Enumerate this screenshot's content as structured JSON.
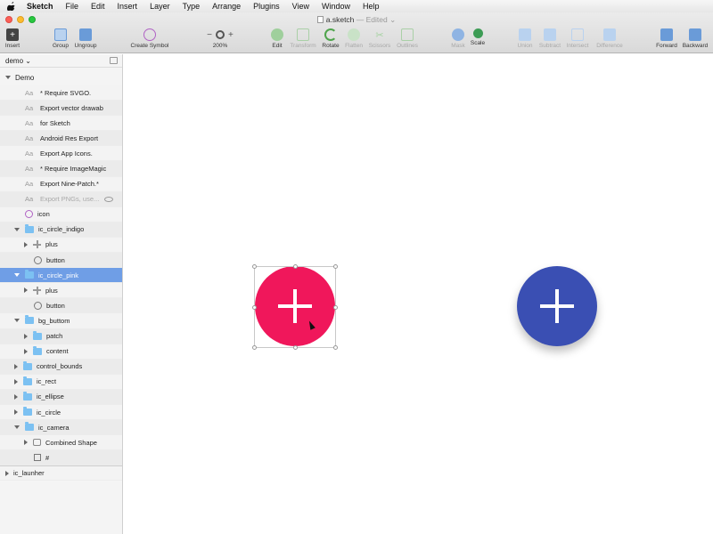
{
  "menubar": {
    "app": "Sketch",
    "items": [
      "File",
      "Edit",
      "Insert",
      "Layer",
      "Type",
      "Arrange",
      "Plugins",
      "View",
      "Window",
      "Help"
    ]
  },
  "window": {
    "title": "a.sketch",
    "status": "— Edited ⌄"
  },
  "toolbar": {
    "insert": "Insert",
    "group": "Group",
    "ungroup": "Ungroup",
    "create_symbol": "Create Symbol",
    "zoom_minus": "−",
    "zoom_plus": "+",
    "zoom": "200%",
    "edit": "Edit",
    "transform": "Transform",
    "rotate": "Rotate",
    "flatten": "Flatten",
    "scissors": "Scissors",
    "outlines": "Outlines",
    "mask": "Mask",
    "scale": "Scale",
    "union": "Union",
    "subtract": "Subtract",
    "intersect": "Intersect",
    "difference": "Difference",
    "forward": "Forward",
    "backward": "Backward"
  },
  "sidebar": {
    "page_selector": "demo ⌄",
    "page": "Demo",
    "layers": [
      {
        "label": "* Require SVGO."
      },
      {
        "label": "Export vector drawab"
      },
      {
        "label": "for Sketch"
      },
      {
        "label": "Android Res Export"
      },
      {
        "label": "Export App Icons."
      },
      {
        "label": "* Require ImageMagic"
      },
      {
        "label": "Export Nine-Patch.*"
      },
      {
        "label": "Export PNGs, use..."
      },
      {
        "label": "icon"
      },
      {
        "label": "ic_circle_indigo"
      },
      {
        "label": "plus"
      },
      {
        "label": "button"
      },
      {
        "label": "ic_circle_pink"
      },
      {
        "label": "plus"
      },
      {
        "label": "button"
      },
      {
        "label": "bg_buttom"
      },
      {
        "label": "patch"
      },
      {
        "label": "content"
      },
      {
        "label": "control_bounds"
      },
      {
        "label": "ic_rect"
      },
      {
        "label": "ic_ellipse"
      },
      {
        "label": "ic_circle"
      },
      {
        "label": "ic_camera"
      },
      {
        "label": "Combined Shape"
      },
      {
        "label": "#"
      },
      {
        "label": "ic_launher"
      }
    ]
  },
  "colors": {
    "pink_fab": "#f0175b",
    "indigo_fab": "#3a4fb3",
    "selection": "#6f9ee6"
  }
}
